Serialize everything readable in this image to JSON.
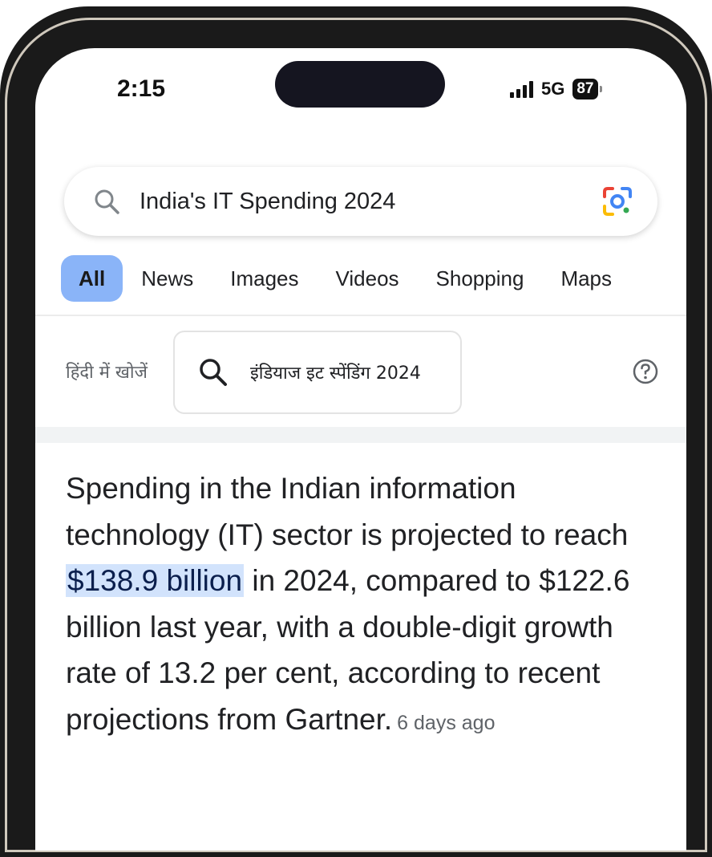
{
  "status_bar": {
    "time": "2:15",
    "network": "5G",
    "battery": "87"
  },
  "search": {
    "query": "India's IT Spending 2024"
  },
  "tabs": [
    {
      "label": "All",
      "active": true
    },
    {
      "label": "News",
      "active": false
    },
    {
      "label": "Images",
      "active": false
    },
    {
      "label": "Videos",
      "active": false
    },
    {
      "label": "Shopping",
      "active": false
    },
    {
      "label": "Maps",
      "active": false
    }
  ],
  "hindi_search": {
    "label": "हिंदी में खोजें",
    "suggestion": "इंडियाज इट स्पेंडिंग 2024"
  },
  "snippet": {
    "text_before": "Spending in the Indian information technology (IT) sector is projected to reach ",
    "highlight": "$138.9 billion",
    "text_after": " in 2024, compared to $122.6 billion last year, with a double-digit growth rate of 13.2 per cent, according to recent projections from Gartner.",
    "date": "6 days ago"
  },
  "colors": {
    "active_tab": "#8ab4f8",
    "highlight": "#d2e3fc",
    "lens_blue": "#4285f4",
    "lens_red": "#ea4335",
    "lens_yellow": "#fbbc05",
    "lens_green": "#34a853"
  },
  "icons": [
    "search-icon",
    "google-lens-icon",
    "signal-icon",
    "battery-icon",
    "help-icon"
  ]
}
